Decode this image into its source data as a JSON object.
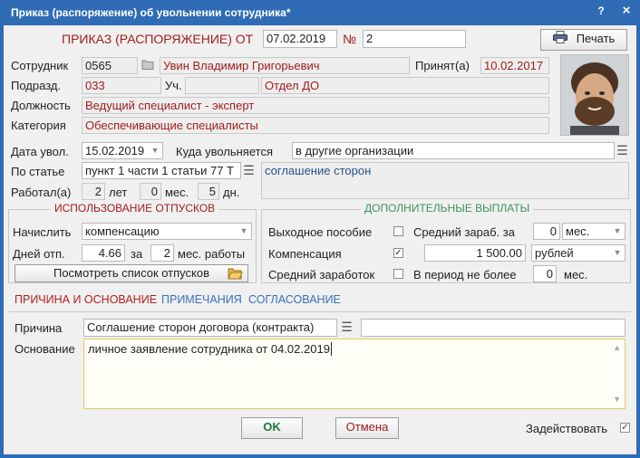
{
  "window": {
    "title": "Приказ (распоряжение) об увольнении сотрудника*",
    "help_label": "?",
    "close_label": "×"
  },
  "header": {
    "heading": "ПРИКАЗ (РАСПОРЯЖЕНИЕ)  ОТ",
    "date": "07.02.2019",
    "number_label": "№",
    "number": "2",
    "print_label": "Печать"
  },
  "employee": {
    "employee_label": "Сотрудник",
    "tab_number": "0565",
    "name": "Увин Владимир Григорьевич",
    "hired_label": "Принят(а)",
    "hired_date": "10.02.2017",
    "department_label": "Подразд.",
    "department_code": "033",
    "section_label": "Уч.",
    "section_value": "",
    "department_name": "Отдел ДО",
    "position_label": "Должность",
    "position": "Ведущий  специалист - эксперт",
    "category_label": "Категория",
    "category": "Обеспечивающие специалисты"
  },
  "dismissal": {
    "date_label": "Дата увол.",
    "date": "15.02.2019",
    "where_label": "Куда увольняется",
    "where": "в другие организации",
    "article_label": "По статье",
    "article": "пункт 1 части 1 статьи 77 Т",
    "article_desc": "соглашение сторон",
    "worked_label": "Работал(а)",
    "years": "2",
    "years_label": "лет",
    "months": "0",
    "months_label": "мес.",
    "days": "5",
    "days_label": "дн."
  },
  "vacations": {
    "title": "ИСПОЛЬЗОВАНИЕ ОТПУСКОВ",
    "accrue_label": "Начислить",
    "accrue_value": "компенсацию",
    "days_label": "Дней отп.",
    "days_value": "4.66",
    "for_label": "за",
    "months_value": "2",
    "months_label": "мес. работы",
    "list_button": "Посмотреть список отпусков"
  },
  "payments": {
    "title": "ДОПОЛНИТЕЛЬНЫЕ ВЫПЛАТЫ",
    "severance_label": "Выходное пособие",
    "severance_checked": false,
    "avg_for_label": "Средний зараб. за",
    "avg_for_value": "0",
    "avg_for_unit": "мес.",
    "comp_label": "Компенсация",
    "comp_checked": true,
    "comp_amount": "1 500.00",
    "comp_unit": "рублей",
    "avg_salary_label": "Средний заработок",
    "avg_salary_checked": false,
    "period_label": "В период не более",
    "period_value": "0",
    "period_unit": "мес."
  },
  "tabs": [
    {
      "label": "ПРИЧИНА И ОСНОВАНИЕ",
      "active": true
    },
    {
      "label": "ПРИМЕЧАНИЯ",
      "active": false
    },
    {
      "label": "СОГЛАСОВАНИЕ",
      "active": false
    }
  ],
  "reason": {
    "reason_label": "Причина",
    "reason_value": "Соглашение сторон договора (контракта)",
    "reason_extra": "",
    "basis_label": "Основание",
    "basis_value": "личное заявление сотрудника от 04.02.2019"
  },
  "footer": {
    "ok_label": "OK",
    "cancel_label": "Отмена",
    "apply_label": "Задействовать",
    "apply_checked": true
  },
  "colors": {
    "title_bar": "#2f6cb5",
    "accent_red": "#a11d1d",
    "accent_blue": "#2b4f8c",
    "active_tab": "#b11e1e",
    "inactive_tab": "#3a70b8"
  }
}
